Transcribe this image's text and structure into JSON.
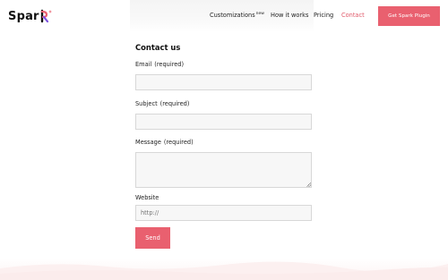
{
  "logo": {
    "text": "Spar",
    "icon": "spark-logo-icon"
  },
  "nav": {
    "items": [
      {
        "label": "Customizations",
        "sup": "new",
        "active": false
      },
      {
        "label": "How it works",
        "active": false
      },
      {
        "label": "Pricing",
        "active": false
      },
      {
        "label": "Contact",
        "active": true
      }
    ],
    "cta_label": "Get Spark Plugin"
  },
  "form": {
    "title": "Contact us",
    "email": {
      "label": "Email",
      "required": "(required)",
      "value": ""
    },
    "subject": {
      "label": "Subject",
      "required": "(required)",
      "value": ""
    },
    "message": {
      "label": "Message",
      "required": "(required)",
      "value": ""
    },
    "website": {
      "label": "Website",
      "placeholder": "http://"
    },
    "send_label": "Send"
  },
  "colors": {
    "accent": "#e9606f",
    "active_link": "#e05a6a",
    "field_bg": "#f7f7f7"
  }
}
